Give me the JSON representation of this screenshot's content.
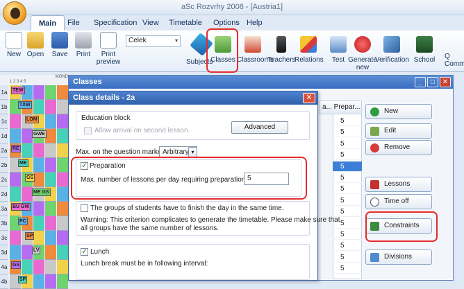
{
  "app": {
    "title": "aSc Rozvrhy 2008  - [Austria1]"
  },
  "tabs": [
    "Main",
    "File",
    "Specification",
    "View",
    "Timetable",
    "Options",
    "Help"
  ],
  "ribbon": {
    "new": "New",
    "open": "Open",
    "save": "Save",
    "print": "Print",
    "print_preview": "Print preview",
    "select_value": "Celek",
    "subjects": "Subjects",
    "classes": "Classes",
    "classrooms": "Classrooms",
    "teachers": "Teachers",
    "relations": "Relations",
    "test": "Test",
    "generate_new": "Generate new",
    "verification": "Verification",
    "school": "School",
    "partial": "Q Comme"
  },
  "grid": {
    "header_day": "MOND",
    "header_periods": "1  2  3  4  5",
    "rows": [
      "1a",
      "1b",
      "1c",
      "1d",
      "2a",
      "2b",
      "2c",
      "2d",
      "3a",
      "3b",
      "3c",
      "3d",
      "4a",
      "4b"
    ],
    "cells": [
      "TEW",
      "TXW",
      "LOM",
      "GWE",
      "RE",
      "ME",
      "GS",
      "ME GS",
      "BU GW",
      "PC",
      "SP",
      "LV",
      "GS",
      "SP"
    ]
  },
  "classes_window": {
    "title": "Classes",
    "list_header": "a...  Prepar...",
    "list_values": [
      "5",
      "5",
      "5",
      "5",
      "5",
      "5",
      "5",
      "5",
      "5",
      "5",
      "5",
      "5",
      "5",
      "5"
    ],
    "buttons": {
      "new": "New",
      "edit": "Edit",
      "remove": "Remove",
      "lessons": "Lessons",
      "time_off": "Time off",
      "constraints": "Constraints",
      "divisions": "Divisions"
    }
  },
  "dialog": {
    "title": "Class details - 2a",
    "education_block": "Education block",
    "allow_arrival": "Allow arrival on second lesson.",
    "advanced": "Advanced",
    "max_question_label": "Max. on the question marked :",
    "max_question_value": "Arbitrary",
    "preparation": "Preparation",
    "prep_label": "Max. number of lessons per day requiring preparation :",
    "prep_value": "5",
    "groups_finish": "The groups of students have to finish the day in the same time.",
    "warning_line1": "Warning: This criterion complicates to generate the timetable. Please make sure that",
    "warning_line2": "all groups have the same number of lessons.",
    "lunch": "Lunch",
    "lunch_desc": "Lunch break must be in following interval:"
  }
}
